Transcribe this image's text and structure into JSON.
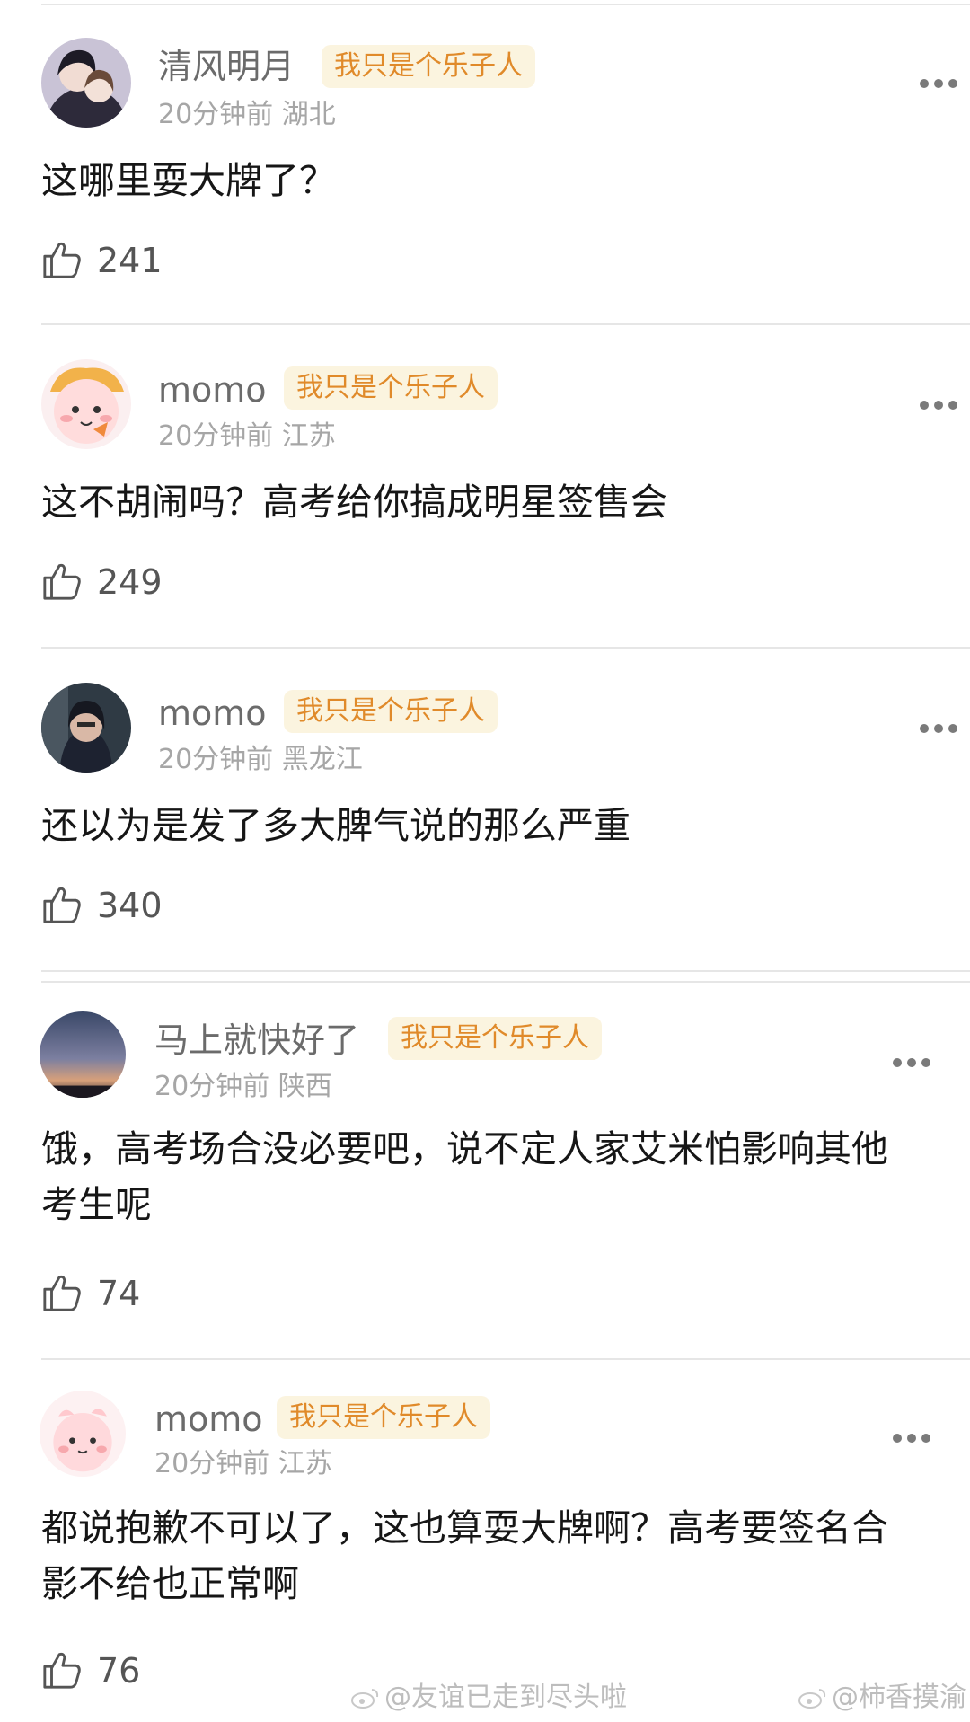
{
  "badge_label": "我只是个乐子人",
  "comments": [
    {
      "username": "清风明月",
      "time": "20分钟前",
      "region": "湖北",
      "text": "这哪里耍大牌了？",
      "likes": "241",
      "avatar_icon": "anime-couple-avatar"
    },
    {
      "username": "momo",
      "time": "20分钟前",
      "region": "江苏",
      "text": "这不胡闹吗？高考给你搞成明星签售会",
      "likes": "249",
      "avatar_icon": "pink-bunny-avatar"
    },
    {
      "username": "momo",
      "time": "20分钟前",
      "region": "黑龙江",
      "text": "还以为是发了多大脾气说的那么严重",
      "likes": "340",
      "avatar_icon": "photo-avatar"
    },
    {
      "username": "马上就快好了",
      "time": "20分钟前",
      "region": "陕西",
      "text": "饿，高考场合没必要吧，说不定人家艾米怕影响其他考生呢",
      "likes": "74",
      "avatar_icon": "sunset-avatar"
    },
    {
      "username": "momo",
      "time": "20分钟前",
      "region": "江苏",
      "text": "都说抱歉不可以了，这也算耍大牌啊？高考要签名合影不给也正常啊",
      "likes": "76",
      "avatar_icon": "pink-bunny-avatar"
    }
  ],
  "watermarks": [
    "@友谊已走到尽头啦",
    "@柿香摸渝"
  ],
  "colors": {
    "badge_bg": "#fbf4df",
    "badge_text": "#e08a2a",
    "username": "#6b6b6b",
    "meta": "#a6a6a6"
  }
}
